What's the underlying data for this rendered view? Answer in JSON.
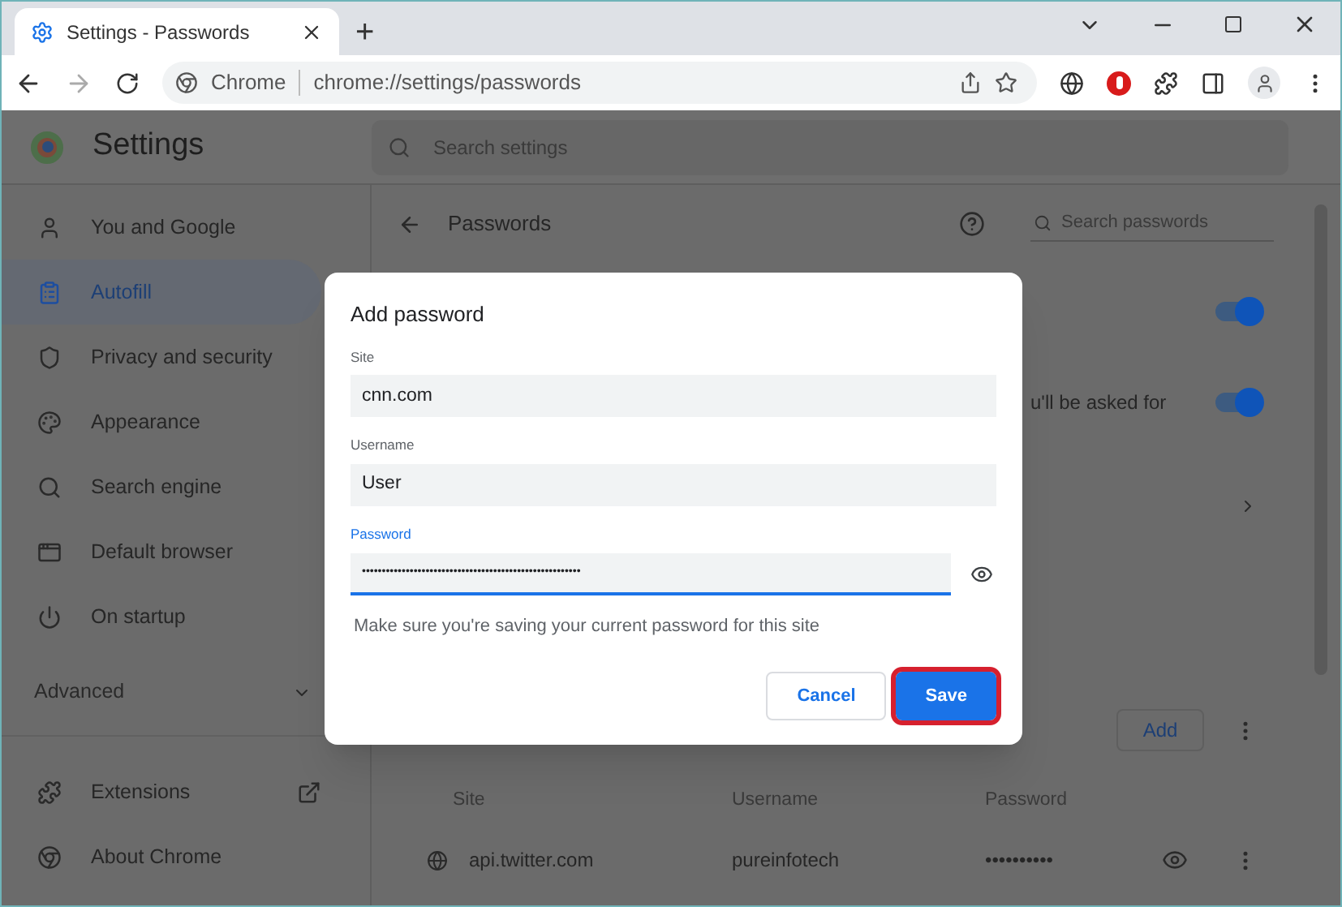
{
  "browser": {
    "tab": {
      "title": "Settings - Passwords",
      "selected": true
    },
    "new_tab": "+",
    "site_chip": "Chrome",
    "url": "chrome://settings/passwords"
  },
  "settings": {
    "title": "Settings",
    "search": {
      "placeholder": "Search settings"
    }
  },
  "sidebar": {
    "items": [
      {
        "label": "You and Google",
        "selected": false
      },
      {
        "label": "Autofill",
        "selected": true
      },
      {
        "label": "Privacy and security",
        "selected": false
      },
      {
        "label": "Appearance",
        "selected": false
      },
      {
        "label": "Search engine",
        "selected": false
      },
      {
        "label": "Default browser",
        "selected": false
      },
      {
        "label": "On startup",
        "selected": false
      }
    ],
    "advanced": {
      "label": "Advanced",
      "expanded": false
    },
    "footer": [
      {
        "label": "Extensions",
        "external": true
      },
      {
        "label": "About Chrome",
        "external": false
      }
    ]
  },
  "content": {
    "title": "Passwords",
    "search": {
      "placeholder": "Search passwords"
    },
    "toggles": [
      {
        "on": true
      },
      {
        "text": "u'll be asked for",
        "on": true
      }
    ],
    "add_button": "Add",
    "table": {
      "columns": [
        "Site",
        "Username",
        "Password"
      ],
      "rows": [
        {
          "site": "api.twitter.com",
          "username": "pureinfotech",
          "password": "••••••••••"
        }
      ]
    }
  },
  "dialog": {
    "title": "Add password",
    "fields": [
      {
        "label": "Site",
        "value": "cnn.com",
        "focused": false,
        "kind": "text"
      },
      {
        "label": "Username",
        "value": "User",
        "focused": false,
        "kind": "text"
      },
      {
        "label": "Password",
        "value": "•••••••••••••••••••••••••••••••••••••••••••••••••••••••",
        "focused": true,
        "kind": "password"
      }
    ],
    "note": "Make sure you're saving your current password for this site",
    "buttons": [
      {
        "label": "Cancel",
        "kind": "secondary",
        "highlighted": false
      },
      {
        "label": "Save",
        "kind": "primary",
        "highlighted": true
      }
    ]
  }
}
